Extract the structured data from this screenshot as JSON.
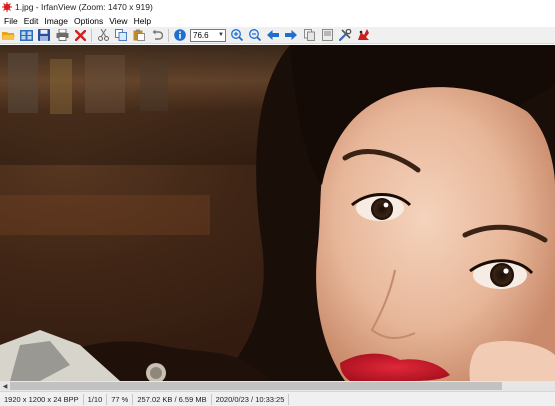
{
  "window": {
    "title": "1.jpg - IrfanView (Zoom: 1470 x 919)"
  },
  "menu": {
    "items": [
      "File",
      "Edit",
      "Image",
      "Options",
      "View",
      "Help"
    ]
  },
  "toolbar": {
    "buttons_left": [
      {
        "icon": "open-folder-icon",
        "color": "#e8a317"
      },
      {
        "icon": "thumbnails-icon",
        "color": "#2e6fb7"
      },
      {
        "icon": "save-icon",
        "color": "#2b4f9e"
      },
      {
        "icon": "print-icon",
        "color": "#555555"
      },
      {
        "icon": "delete-icon",
        "color": "#d02020"
      }
    ],
    "buttons_edit": [
      {
        "icon": "cut-icon",
        "color": "#666666"
      },
      {
        "icon": "copy-icon",
        "color": "#4a7fc1"
      },
      {
        "icon": "paste-icon",
        "color": "#c08a30"
      },
      {
        "icon": "undo-icon",
        "color": "#777777"
      }
    ],
    "info_icon": {
      "icon": "info-icon",
      "color": "#1f6fd0"
    },
    "zoom_value": "76.6",
    "buttons_right": [
      {
        "icon": "zoom-in-icon",
        "color": "#1f6fd0"
      },
      {
        "icon": "zoom-out-icon",
        "color": "#1f6fd0"
      },
      {
        "icon": "previous-icon",
        "color": "#1f6fd0"
      },
      {
        "icon": "next-icon",
        "color": "#1f6fd0"
      },
      {
        "icon": "copy-page-icon",
        "color": "#8a8a8a"
      },
      {
        "icon": "slideshow-icon",
        "color": "#8a8a8a"
      },
      {
        "icon": "settings-icon",
        "color": "#444444"
      },
      {
        "icon": "irfanview-logo-icon",
        "color": "#d01c1c"
      }
    ]
  },
  "status": {
    "cells": [
      "1920 x 1200 x 24 BPP",
      "1/10",
      "77 %",
      "257.02 KB / 6.59 MB",
      "2020/0/23 / 10:33:25"
    ]
  },
  "colors": {
    "toolbar_bg": "#f0f0f0",
    "accent_blue": "#1f6fd0"
  }
}
